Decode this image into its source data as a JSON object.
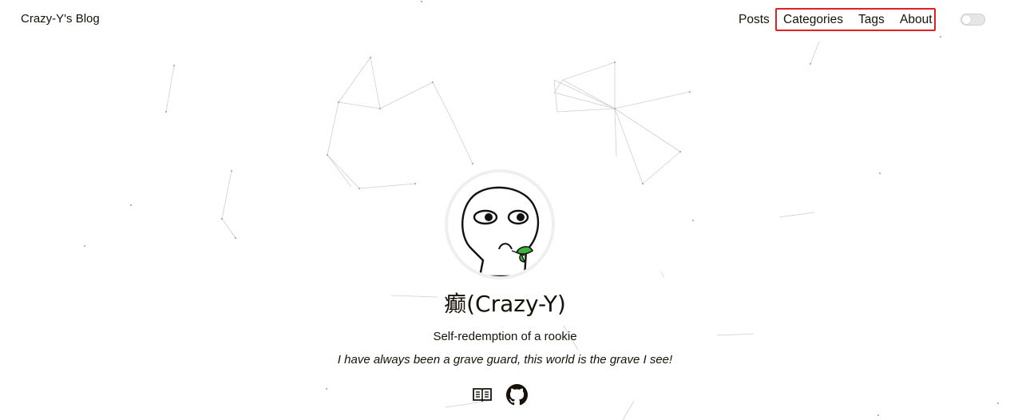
{
  "header": {
    "brand": "Crazy-Y's Blog",
    "nav": [
      {
        "label": "Posts"
      },
      {
        "label": "Categories"
      },
      {
        "label": "Tags"
      },
      {
        "label": "About"
      }
    ],
    "theme_toggle_icon": "toggle-switch-icon",
    "highlight_color": "#e02020"
  },
  "profile": {
    "avatar_icon": "meme-face-avatar",
    "title": "癫(Crazy-Y)",
    "subtitle": "Self-redemption of a rookie",
    "motto": "I have always been a grave guard, this world is the grave I see!",
    "social": [
      {
        "icon": "book-icon"
      },
      {
        "icon": "github-icon"
      }
    ]
  }
}
